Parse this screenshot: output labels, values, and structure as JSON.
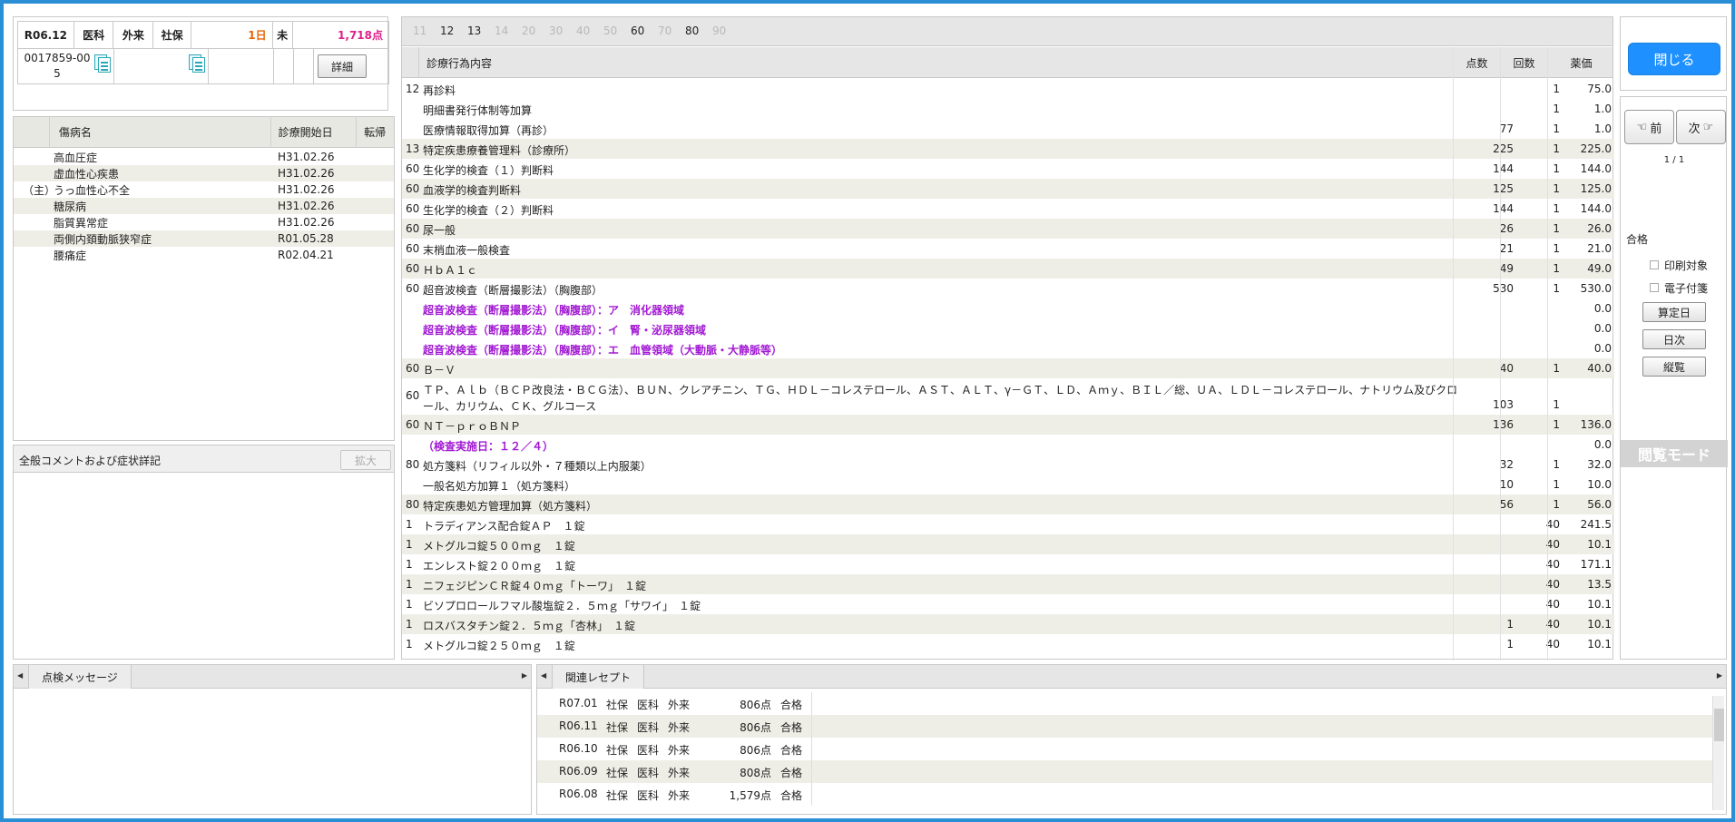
{
  "header": {
    "month": "R06.12",
    "dept": "医科",
    "type": "外来",
    "insurance": "社保",
    "days": "1日",
    "status": "未",
    "points": "1,718点",
    "patient_id": "0017859-005",
    "detail_button": "詳細"
  },
  "diseases": {
    "columns": [
      "傷病名",
      "診療開始日",
      "転帰"
    ],
    "rows": [
      {
        "main": "",
        "name": "高血圧症",
        "date": "H31.02.26"
      },
      {
        "main": "",
        "name": "虚血性心疾患",
        "date": "H31.02.26"
      },
      {
        "main": "（主）",
        "name": "うっ血性心不全",
        "date": "H31.02.26"
      },
      {
        "main": "",
        "name": "糖尿病",
        "date": "H31.02.26"
      },
      {
        "main": "",
        "name": "脂質異常症",
        "date": "H31.02.26"
      },
      {
        "main": "",
        "name": "両側内頚動脈狭窄症",
        "date": "R01.05.28"
      },
      {
        "main": "",
        "name": "腰痛症",
        "date": "R02.04.21"
      }
    ]
  },
  "comment": {
    "title": "全般コメントおよび症状詳記",
    "expand_button": "拡大"
  },
  "tabs": [
    {
      "label": "11",
      "active": false
    },
    {
      "label": "12",
      "active": true
    },
    {
      "label": "13",
      "active": true
    },
    {
      "label": "14",
      "active": false
    },
    {
      "label": "20",
      "active": false
    },
    {
      "label": "30",
      "active": false
    },
    {
      "label": "40",
      "active": false
    },
    {
      "label": "50",
      "active": false
    },
    {
      "label": "60",
      "active": true
    },
    {
      "label": "70",
      "active": false
    },
    {
      "label": "80",
      "active": true
    },
    {
      "label": "90",
      "active": false
    }
  ],
  "procedures": {
    "columns": {
      "name": "診療行為内容",
      "points": "点数",
      "count": "回数",
      "price": "薬価"
    },
    "rows": [
      {
        "code": "12",
        "name": "再診料",
        "points": "",
        "count": "1",
        "price": "75.0",
        "purple": false,
        "alt": false,
        "h": 22
      },
      {
        "code": "",
        "name": "明細書発行体制等加算",
        "points": "",
        "count": "1",
        "price": "1.0",
        "purple": false,
        "alt": false,
        "h": 22
      },
      {
        "code": "",
        "name": "医療情報取得加算（再診）",
        "points": "77",
        "count": "1",
        "price": "1.0",
        "purple": false,
        "alt": false,
        "h": 22
      },
      {
        "code": "13",
        "name": "特定疾患療養管理料（診療所）",
        "points": "225",
        "count": "1",
        "price": "225.0",
        "purple": false,
        "alt": true,
        "h": 22
      },
      {
        "code": "60",
        "name": "生化学的検査（１）判断料",
        "points": "144",
        "count": "1",
        "price": "144.0",
        "purple": false,
        "alt": false,
        "h": 22
      },
      {
        "code": "60",
        "name": "血液学的検査判断料",
        "points": "125",
        "count": "1",
        "price": "125.0",
        "purple": false,
        "alt": true,
        "h": 22
      },
      {
        "code": "60",
        "name": "生化学的検査（２）判断料",
        "points": "144",
        "count": "1",
        "price": "144.0",
        "purple": false,
        "alt": false,
        "h": 22
      },
      {
        "code": "60",
        "name": "尿一般",
        "points": "26",
        "count": "1",
        "price": "26.0",
        "purple": false,
        "alt": true,
        "h": 22
      },
      {
        "code": "60",
        "name": "末梢血液一般検査",
        "points": "21",
        "count": "1",
        "price": "21.0",
        "purple": false,
        "alt": false,
        "h": 22
      },
      {
        "code": "60",
        "name": "ＨｂＡ１ｃ",
        "points": "49",
        "count": "1",
        "price": "49.0",
        "purple": false,
        "alt": true,
        "h": 22
      },
      {
        "code": "60",
        "name": "超音波検査（断層撮影法）（胸腹部）",
        "points": "530",
        "count": "1",
        "price": "530.0",
        "purple": false,
        "alt": false,
        "h": 22
      },
      {
        "code": "",
        "name": "超音波検査（断層撮影法）（胸腹部）：ア　消化器領域",
        "points": "",
        "count": "",
        "price": "0.0",
        "purple": true,
        "alt": false,
        "h": 22
      },
      {
        "code": "",
        "name": "超音波検査（断層撮影法）（胸腹部）：イ　腎・泌尿器領域",
        "points": "",
        "count": "",
        "price": "0.0",
        "purple": true,
        "alt": false,
        "h": 22
      },
      {
        "code": "",
        "name": "超音波検査（断層撮影法）（胸腹部）：エ　血管領域（大動脈・大静脈等）",
        "points": "",
        "count": "",
        "price": "0.0",
        "purple": true,
        "alt": false,
        "h": 22
      },
      {
        "code": "60",
        "name": "Ｂ－Ｖ",
        "points": "40",
        "count": "1",
        "price": "40.0",
        "purple": false,
        "alt": true,
        "h": 22
      },
      {
        "code": "60",
        "name": "ＴＰ、Ａｌｂ（ＢＣＰ改良法・ＢＣＧ法）、ＢＵＮ、クレアチニン、ＴＧ、ＨＤＬ－コレステロール、ＡＳＴ、ＡＬＴ、γ－ＧＴ、ＬＤ、Ａｍｙ、ＢＩＬ／総、ＵＡ、ＬＤＬ－コレステロール、ナトリウム及びクロ",
        "name2": "ール、カリウム、ＣＫ、グルコース",
        "points": "103",
        "count": "1",
        "price": "",
        "purple": false,
        "alt": false,
        "h": 40
      },
      {
        "code": "60",
        "name": "ＮＴ－ｐｒｏＢＮＰ",
        "points": "136",
        "count": "1",
        "price": "136.0",
        "purple": false,
        "alt": true,
        "h": 22
      },
      {
        "code": "",
        "name": "（検査実施日：１２／４）",
        "points": "",
        "count": "",
        "price": "0.0",
        "purple": true,
        "alt": false,
        "h": 22
      },
      {
        "code": "80",
        "name": "処方箋料（リフィル以外・７種類以上内服薬）",
        "points": "32",
        "count": "1",
        "price": "32.0",
        "purple": false,
        "alt": false,
        "h": 22
      },
      {
        "code": "",
        "name": "一般名処方加算１（処方箋料）",
        "points": "10",
        "count": "1",
        "price": "10.0",
        "purple": false,
        "alt": false,
        "h": 22
      },
      {
        "code": "80",
        "name": "特定疾患処方管理加算（処方箋料）",
        "points": "56",
        "count": "1",
        "price": "56.0",
        "purple": false,
        "alt": true,
        "h": 22
      },
      {
        "code": "1",
        "name": "トラディアンス配合錠ＡＰ　１錠",
        "points": "",
        "count": "40",
        "price": "241.5",
        "purple": false,
        "alt": false,
        "h": 22
      },
      {
        "code": "1",
        "name": "メトグルコ錠５００ｍｇ　１錠",
        "points": "",
        "count": "40",
        "price": "10.1",
        "purple": false,
        "alt": true,
        "h": 22
      },
      {
        "code": "1",
        "name": "エンレスト錠２００ｍｇ　１錠",
        "points": "",
        "count": "40",
        "price": "171.1",
        "purple": false,
        "alt": false,
        "h": 22
      },
      {
        "code": "1",
        "name": "ニフェジピンＣＲ錠４０ｍｇ「トーワ」　１錠",
        "points": "",
        "count": "40",
        "price": "13.5",
        "purple": false,
        "alt": true,
        "h": 22
      },
      {
        "code": "1",
        "name": "ビソプロロールフマル酸塩錠２．５ｍｇ「サワイ」　１錠",
        "points": "",
        "count": "40",
        "price": "10.1",
        "purple": false,
        "alt": false,
        "h": 22
      },
      {
        "code": "1",
        "name": "ロスバスタチン錠２．５ｍｇ「杏林」　１錠",
        "points": "1",
        "count": "40",
        "price": "10.1",
        "purple": false,
        "alt": true,
        "h": 22
      },
      {
        "code": "1",
        "name": "メトグルコ錠２５０ｍｇ　１錠",
        "points": "1",
        "count": "40",
        "price": "10.1",
        "purple": false,
        "alt": false,
        "h": 22
      }
    ]
  },
  "sidebar": {
    "close_button": "閉じる",
    "prev_button": "前",
    "next_button": "次",
    "page_indicator": "1 / 1",
    "result": "合格",
    "print_target": "印刷対象",
    "e_attach": "電子付箋",
    "calc_date_button": "算定日",
    "daily_button": "日次",
    "vertical_button": "縦覧",
    "view_mode": "閲覧モード"
  },
  "check_messages": {
    "tab": "点検メッセージ"
  },
  "related": {
    "tab": "関連レセプト",
    "rows": [
      {
        "month": "R07.01",
        "ins": "社保",
        "dept": "医科",
        "type": "外来",
        "points": "806点",
        "result": "合格"
      },
      {
        "month": "R06.11",
        "ins": "社保",
        "dept": "医科",
        "type": "外来",
        "points": "806点",
        "result": "合格"
      },
      {
        "month": "R06.10",
        "ins": "社保",
        "dept": "医科",
        "type": "外来",
        "points": "806点",
        "result": "合格"
      },
      {
        "month": "R06.09",
        "ins": "社保",
        "dept": "医科",
        "type": "外来",
        "points": "808点",
        "result": "合格"
      },
      {
        "month": "R06.08",
        "ins": "社保",
        "dept": "医科",
        "type": "外来",
        "points": "1,579点",
        "result": "合格"
      }
    ]
  },
  "colors": {
    "accent": "#1e90ff",
    "purple_text": "#a21ad3",
    "days_text": "#e8650a",
    "points_text": "#e0208c",
    "row_alt": "#efeee6"
  }
}
